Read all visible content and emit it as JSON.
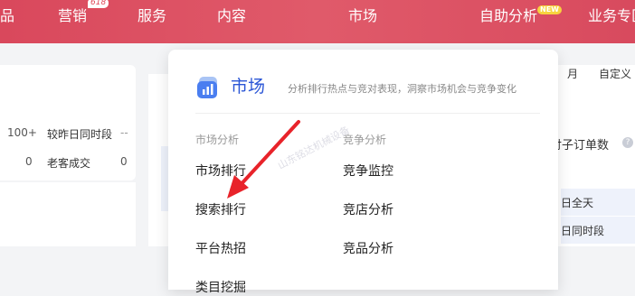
{
  "nav": {
    "items": [
      "品",
      "营销",
      "服务",
      "内容",
      "市场",
      "自助分析",
      "业务专区"
    ],
    "badge_618": "618",
    "badge_new": "NEW"
  },
  "left_card": {
    "val1": "100+",
    "label1": "较昨日同时段",
    "dash": "--",
    "val2": "0",
    "label2": "老客成交",
    "val3": "0"
  },
  "right_panel": {
    "tab_month": "月",
    "tab_custom": "自定义",
    "metric_label": "付子订单数",
    "help": "?",
    "row1": "日全天",
    "row2": "日同时段"
  },
  "dropdown": {
    "title": "市场",
    "description": "分析排行热点与竞对表现，洞察市场机会与竞争变化",
    "group_market": "市场分析",
    "group_compete": "竞争分析",
    "market_items": [
      "市场排行",
      "搜索排行",
      "平台热招",
      "类目挖掘"
    ],
    "compete_items": [
      "竞争监控",
      "竞店分析",
      "竞品分析"
    ],
    "watermark": "山东铭达机械设备"
  },
  "colors": {
    "nav_bg": "#d9485c",
    "accent": "#2b56d6",
    "arrow": "#e8232a"
  }
}
